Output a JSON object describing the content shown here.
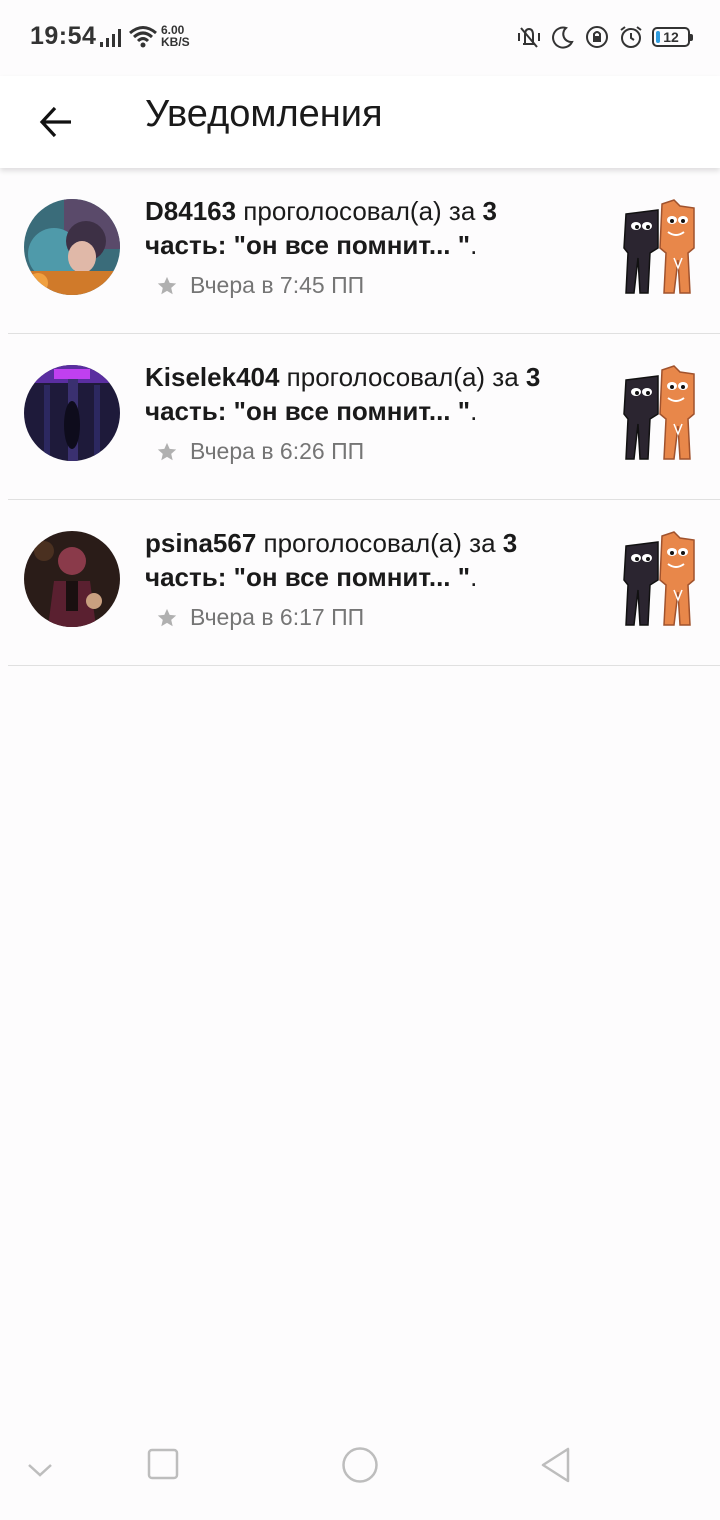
{
  "status_bar": {
    "time": "19:54",
    "net_speed_value": "6.00",
    "net_speed_unit": "KB/S",
    "battery_level": "12",
    "icons": [
      "signal-icon",
      "wifi-icon",
      "vibrate-icon",
      "moon-icon",
      "rotation-lock-icon",
      "alarm-icon",
      "battery-icon"
    ]
  },
  "header": {
    "title": "Уведомления",
    "back_icon": "arrow-left-icon"
  },
  "notifications": [
    {
      "user": "D84163",
      "action": " проголосовал(а) за ",
      "part": "3 часть: \"он все помнит... \"",
      "end": ".",
      "time": "Вчера в 7:45 ПП"
    },
    {
      "user": "Kiselek404",
      "action": " проголосовал(а) за ",
      "part": "3 часть: \"он все помнит... \"",
      "end": ".",
      "time": "Вчера в 6:26 ПП"
    },
    {
      "user": "psina567",
      "action": " проголосовал(а) за ",
      "part": "3 часть: \"он все помнит... \"",
      "end": ".",
      "time": "Вчера в 6:17 ПП"
    }
  ],
  "colors": {
    "background": "#fdfcfd",
    "meta_text": "#757575",
    "star": "#b0b0b0",
    "divider": "#e0e0e0"
  }
}
